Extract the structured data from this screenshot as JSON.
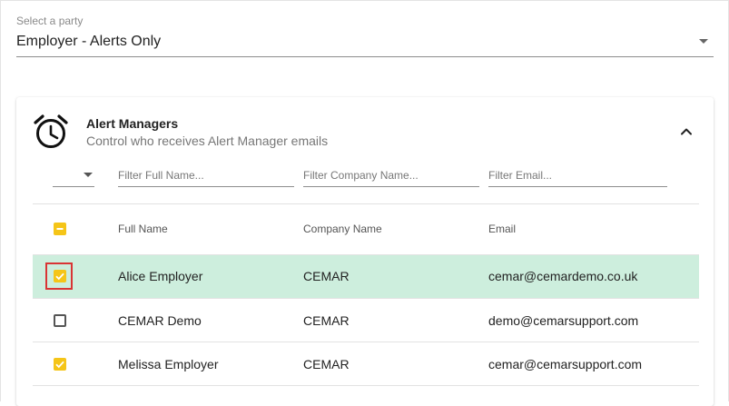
{
  "party_select": {
    "label": "Select a party",
    "value": "Employer - Alerts Only"
  },
  "alert_managers": {
    "icon": "alarm-clock-icon",
    "title": "Alert Managers",
    "subtitle": "Control who receives Alert Manager emails",
    "filters": {
      "full_name_placeholder": "Filter Full Name...",
      "company_name_placeholder": "Filter Company Name...",
      "email_placeholder": "Filter Email..."
    },
    "columns": {
      "full_name": "Full Name",
      "company_name": "Company Name",
      "email": "Email"
    },
    "rows": [
      {
        "full_name": "Alice Employer",
        "company_name": "CEMAR",
        "email": "cemar@cemardemo.co.uk",
        "checked": true,
        "highlighted": true
      },
      {
        "full_name": "CEMAR Demo",
        "company_name": "CEMAR",
        "email": "demo@cemarsupport.com",
        "checked": false,
        "highlighted": false
      },
      {
        "full_name": "Melissa Employer",
        "company_name": "CEMAR",
        "email": "cemar@cemarsupport.com",
        "checked": true,
        "highlighted": false
      }
    ]
  },
  "colors": {
    "accent_yellow": "#f5c518",
    "row_highlight": "#cdeedd",
    "focus_outline": "#d93434"
  }
}
